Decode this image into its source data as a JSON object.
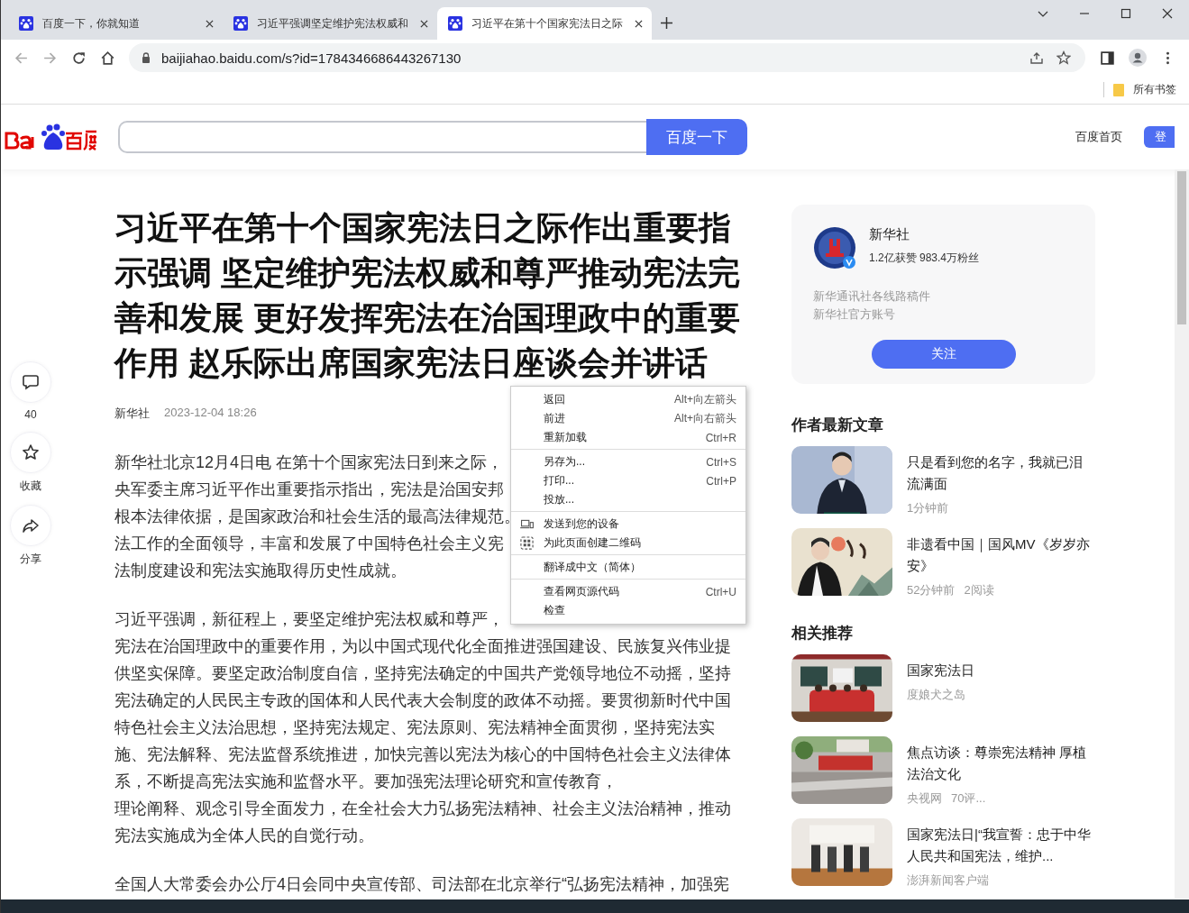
{
  "tabs": [
    {
      "title": "百度一下，你就知道",
      "selected": false
    },
    {
      "title": "习近平强调坚定维护宪法权威和",
      "selected": false
    },
    {
      "title": "习近平在第十个国家宪法日之际",
      "selected": true
    }
  ],
  "address": "baijiahao.baidu.com/s?id=1784346686443267130",
  "bookmarks_label": "所有书签",
  "site_header": {
    "search_button": "百度一下",
    "home_link": "百度首页",
    "login_button": "登"
  },
  "article": {
    "title": "习近平在第十个国家宪法日之际作出重要指示强调 坚定维护宪法权威和尊严推动宪法完善和发展 更好发挥宪法在治国理政中的重要作用 赵乐际出席国家宪法日座谈会并讲话",
    "source": "新华社",
    "date": "2023-12-04 18:26",
    "paragraphs": [
      [
        "新华社北京12月4日电 在第十个国家宪法日到来之际，",
        "央军委主席习近平作出重要指示指出，宪法是治国安邦",
        "根本法律依据，是国家政治和社会生活的最高法律规范。",
        "法工作的全面领导，丰富和发展了中国特色社会主义宪",
        "法制度建设和宪法实施取得历史性成就。"
      ],
      [
        "习近平强调，新征程上，要坚定维护宪法权威和尊严，",
        "宪法在治国理政中的重要作用，为以中国式现代化全面推进强国建设、民族复兴伟业提",
        "供坚实保障。要坚定政治制度自信，坚持宪法确定的中国共产党领导地位不动摇，坚持",
        "宪法确定的人民民主专政的国体和人民代表大会制度的政体不动摇。要贯彻新时代中国",
        "特色社会主义法治思想，坚持宪法规定、宪法原则、宪法精神全面贯彻，坚持宪法实",
        "施、宪法解释、宪法监督系统推进，加快完善以宪法为核心的中国特色社会主义法律体",
        "系，不断提高宪法实施和监督水平。要加强宪法理论研究和宣传教育，",
        "理论阐释、观念引导全面发力，在全社会大力弘扬宪法精神、社会主义法治精神，推动",
        "宪法实施成为全体人民的自觉行动。"
      ],
      [
        "全国人大常委会办公厅4日会同中央宣传部、司法部在北京举行“弘扬宪法精神，加强宪"
      ]
    ]
  },
  "actions": [
    {
      "kind": "comment",
      "label": "40"
    },
    {
      "kind": "favorite",
      "label": "收藏"
    },
    {
      "kind": "share",
      "label": "分享"
    }
  ],
  "author": {
    "name": "新华社",
    "stats": "1.2亿获赞 983.4万粉丝",
    "description": [
      "新华通讯社各线路稿件",
      "新华社官方账号"
    ],
    "follow_button": "关注"
  },
  "latest_heading": "作者最新文章",
  "latest": [
    {
      "title": "只是看到您的名字，我就已泪流满面",
      "meta": [
        "1分钟前"
      ]
    },
    {
      "title": "非遗看中国｜国风MV《岁岁亦安》",
      "meta": [
        "52分钟前",
        "2阅读"
      ]
    }
  ],
  "related_heading": "相关推荐",
  "related": [
    {
      "title": "国家宪法日",
      "meta": [
        "度娘犬之岛"
      ]
    },
    {
      "title": "焦点访谈：尊崇宪法精神 厚植法治文化",
      "meta": [
        "央视网",
        "70评..."
      ]
    },
    {
      "title": "国家宪法日|“我宣誓：忠于中华人民共和国宪法，维护...",
      "meta": [
        "澎湃新闻客户端"
      ]
    }
  ],
  "context_menu": [
    [
      {
        "kind": "text",
        "label": "返回",
        "shortcut": "Alt+向左箭头"
      },
      {
        "kind": "text",
        "label": "前进",
        "shortcut": "Alt+向右箭头"
      },
      {
        "kind": "text",
        "label": "重新加载",
        "shortcut": "Ctrl+R"
      }
    ],
    [
      {
        "kind": "text",
        "label": "另存为...",
        "shortcut": "Ctrl+S"
      },
      {
        "kind": "text",
        "label": "打印...",
        "shortcut": "Ctrl+P"
      },
      {
        "kind": "text",
        "label": "投放..."
      }
    ],
    [
      {
        "kind": "device",
        "label": "发送到您的设备"
      },
      {
        "kind": "qr",
        "label": "为此页面创建二维码"
      }
    ],
    [
      {
        "kind": "text",
        "label": "翻译成中文（简体）"
      }
    ],
    [
      {
        "kind": "text",
        "label": "查看网页源代码",
        "shortcut": "Ctrl+U"
      },
      {
        "kind": "text",
        "label": "检查"
      }
    ]
  ]
}
